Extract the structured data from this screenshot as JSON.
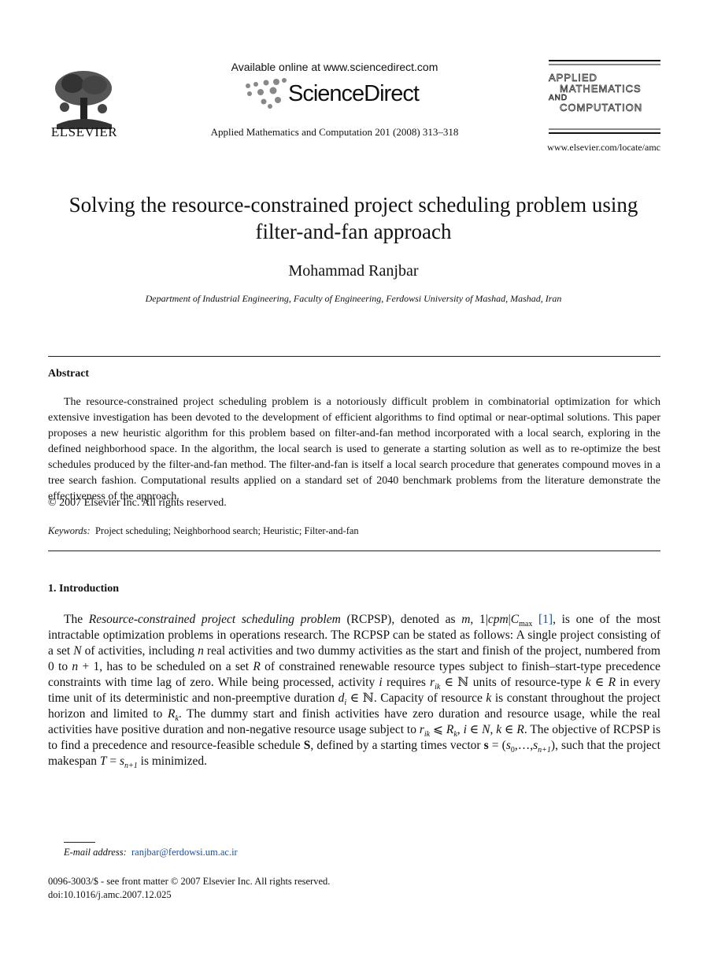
{
  "header": {
    "publisher": "ELSEVIER",
    "available_online": "Available online at www.sciencedirect.com",
    "platform": "ScienceDirect",
    "journal_citation": "Applied Mathematics and Computation 201 (2008) 313–318",
    "journal_logo_lines": [
      "APPLIED",
      "MATHEMATICS",
      "AND",
      "COMPUTATION"
    ],
    "journal_url": "www.elsevier.com/locate/amc"
  },
  "article": {
    "title": "Solving the resource-constrained project scheduling problem using filter-and-fan approach",
    "author": "Mohammad Ranjbar",
    "affiliation": "Department of Industrial Engineering, Faculty of Engineering, Ferdowsi University of Mashad, Mashad, Iran"
  },
  "abstract": {
    "heading": "Abstract",
    "text": "The resource-constrained project scheduling problem is a notoriously difficult problem in combinatorial optimization for which extensive investigation has been devoted to the development of efficient algorithms to find optimal or near-optimal solutions. This paper proposes a new heuristic algorithm for this problem based on filter-and-fan method incorporated with a local search, exploring in the defined neighborhood space. In the algorithm, the local search is used to generate a starting solution as well as to re-optimize the best schedules produced by the filter-and-fan method. The filter-and-fan is itself a local search procedure that generates compound moves in a tree search fashion. Computational results applied on a standard set of 2040 benchmark problems from the literature demonstrate the effectiveness of the approach.",
    "copyright": "© 2007 Elsevier Inc. All rights reserved."
  },
  "keywords": {
    "label": "Keywords:",
    "items": "Project scheduling; Neighborhood search; Heuristic; Filter-and-fan"
  },
  "introduction": {
    "heading": "1. Introduction",
    "segments": {
      "s1": "The ",
      "s2": "Resource-constrained project scheduling problem",
      "s3": " (RCPSP), denoted as ",
      "s4": "m",
      "s5": ", 1|",
      "s6": "cpm",
      "s7": "|",
      "s8": "C",
      "s9": "max",
      "s10": " ",
      "ref": "[1]",
      "s11": ", is one of the most intractable optimization problems in operations research. The RCPSP can be stated as follows: A single project consisting of a set ",
      "s12": "N",
      "s13": " of activities, including ",
      "s14": "n",
      "s15": " real activities and two dummy activities as the start and finish of the project, numbered from 0 to ",
      "s16": "n",
      "s17": " + 1, has to be scheduled on a set ",
      "s18": "R",
      "s19": " of constrained renewable resource types subject to finish–start-type precedence constraints with time lag of zero. While being processed, activity ",
      "s20": "i",
      "s21": " requires ",
      "s22": "r",
      "s23": "ik",
      "s24": " ∈ ℕ units of resource-type ",
      "s25": "k",
      "s26": " ∈ ",
      "s27": "R",
      "s28": " in every time unit of its deterministic and non-preemptive duration ",
      "s29": "d",
      "s30": "i",
      "s31": " ∈ ℕ. Capacity of resource ",
      "s32": "k",
      "s33": " is constant throughout the project horizon and limited to ",
      "s34": "R",
      "s35": "k",
      "s36": ". The dummy start and finish activities have zero duration and resource usage, while the real activities have positive duration and non-negative resource usage subject to ",
      "s37": "r",
      "s38": "ik",
      "s39": " ⩽ ",
      "s40": "R",
      "s41": "k",
      "s42": ", ",
      "s43": "i",
      "s44": " ∈ ",
      "s45": "N",
      "s46": ", ",
      "s47": "k",
      "s48": " ∈ ",
      "s49": "R",
      "s50": ". The objective of RCPSP is to find a precedence and resource-feasible schedule ",
      "s51": "S",
      "s52": ", defined by a starting times vector ",
      "s53": "s",
      "s54": " = (",
      "s55": "s",
      "s56": "0",
      "s57": ",…,",
      "s58": "s",
      "s59": "n+1",
      "s60": "), such that the project makespan ",
      "s61": "T",
      "s62": " = ",
      "s63": "s",
      "s64": "n+1",
      "s65": " is minimized."
    }
  },
  "footnote": {
    "email_label": "E-mail address:",
    "email": "ranjbar@ferdowsi.um.ac.ir",
    "issn_line": "0096-3003/$ - see front matter © 2007 Elsevier Inc. All rights reserved.",
    "doi": "doi:10.1016/j.amc.2007.12.025"
  }
}
